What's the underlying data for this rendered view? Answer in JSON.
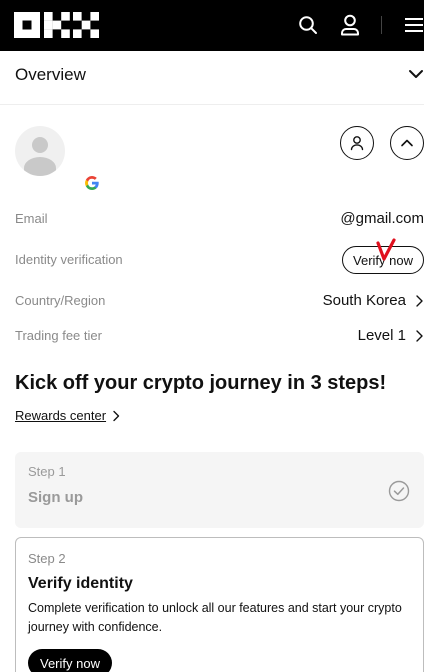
{
  "header": {
    "logo": "OKX",
    "icons": [
      "search-icon",
      "user-icon",
      "menu-icon"
    ]
  },
  "overview": {
    "title": "Overview"
  },
  "profile": {
    "login_provider": "google"
  },
  "info": {
    "email_label": "Email",
    "email_value": "@gmail.com",
    "identity_label": "Identity verification",
    "identity_button": "Verify now",
    "country_label": "Country/Region",
    "country_value": "South Korea",
    "fee_label": "Trading fee tier",
    "fee_value": "Level 1"
  },
  "journey": {
    "headline": "Kick off your crypto journey in 3 steps!",
    "rewards_link": "Rewards center"
  },
  "steps": [
    {
      "num": "Step 1",
      "title": "Sign up",
      "status": "completed"
    },
    {
      "num": "Step 2",
      "title": "Verify identity",
      "desc": "Complete verification to unlock all our features and start your crypto journey with confidence.",
      "cta": "Verify now"
    }
  ],
  "colors": {
    "topbar": "#000000",
    "muted_text": "#8a8a8a",
    "annotation_mark": "#e0101e",
    "completed_card": "#f5f5f5"
  }
}
